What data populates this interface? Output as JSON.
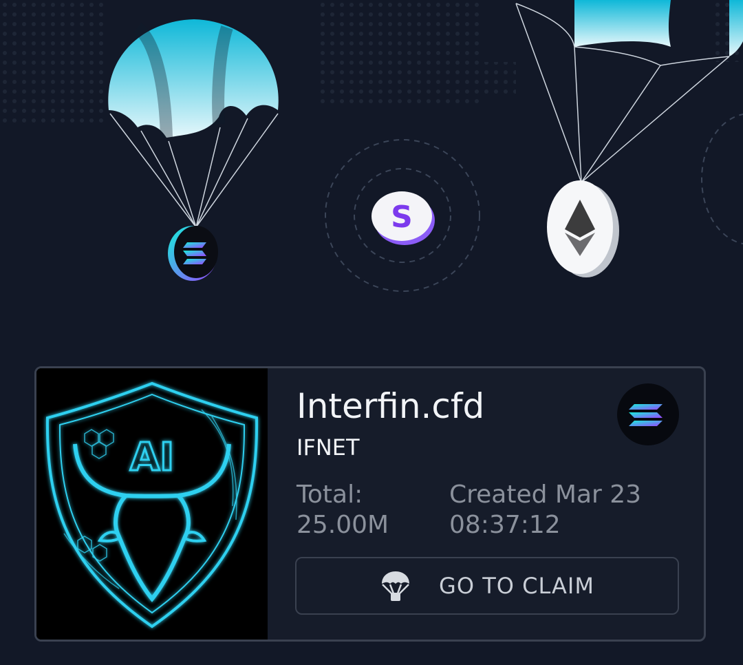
{
  "airdrop": {
    "name": "Interfin.cfd",
    "symbol": "IFNET",
    "total_label": "Total:",
    "total_value": "25.00M",
    "created_label": "Created Mar 23",
    "created_time": "08:37:12",
    "logo_text": "AI",
    "chain_icon": "solana-logo-icon",
    "claim_button_label": "GO TO CLAIM",
    "claim_icon": "parachute-icon"
  },
  "hero": {
    "coins": [
      "solana-coin-icon",
      "synapse-coin-icon",
      "ethereum-coin-icon"
    ]
  },
  "colors": {
    "background": "#121827",
    "card_border": "#3a4150",
    "accent_cyan": "#19c6e6",
    "muted_text": "#8b919c"
  }
}
